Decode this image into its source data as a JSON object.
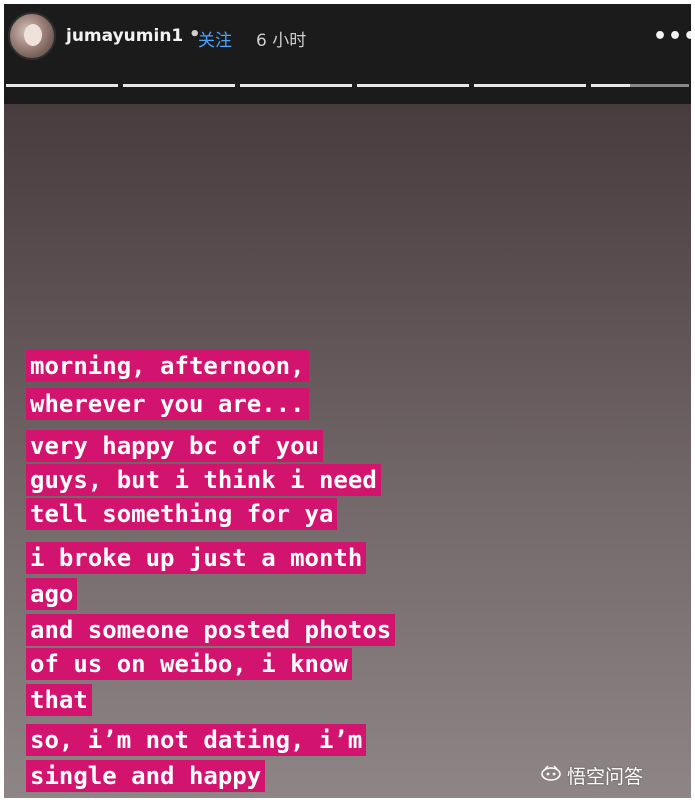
{
  "header": {
    "username": "jumayumin1",
    "separator": "•",
    "follow_label": "关注",
    "time_ago": "6 小时",
    "more_label": "•••"
  },
  "story": {
    "lines": [
      "morning, afternoon,",
      "wherever you are...",
      "very happy bc of you",
      "guys, but i think i need",
      "tell something for ya",
      "i broke up just a month",
      "ago",
      "and someone posted photos",
      "of us on weibo, i know",
      "that",
      "so, i’m not dating, i’m",
      "single and happy"
    ],
    "highlight_color": "#d2146f"
  },
  "watermark": {
    "label": "悟空问答",
    "icon": "wukong-logo-icon"
  }
}
